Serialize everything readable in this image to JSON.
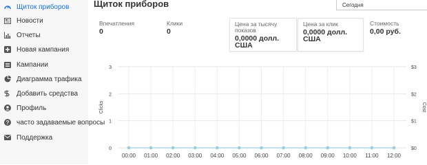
{
  "sidebar": {
    "items": [
      {
        "label": "Щиток приборов",
        "icon": "dashboard-icon",
        "active": true
      },
      {
        "label": "Новости",
        "icon": "news-icon"
      },
      {
        "label": "Отчеты",
        "icon": "reports-chart-icon"
      },
      {
        "label": "Новая кампания",
        "icon": "plus-square-icon"
      },
      {
        "label": "Кампании",
        "icon": "list-icon"
      },
      {
        "label": "Диаграмма трафика",
        "icon": "pie-chart-icon"
      },
      {
        "label": "Добавить средства",
        "icon": "money-icon"
      },
      {
        "label": "Профиль",
        "icon": "user-icon"
      },
      {
        "label": "часто задаваемые вопросы",
        "icon": "question-circle-icon"
      },
      {
        "label": "Поддержка",
        "icon": "envelope-icon"
      }
    ]
  },
  "header": {
    "title": "Щиток приборов",
    "period_select": "Сегодня"
  },
  "stats": [
    {
      "label": "Впечатления",
      "value": "0"
    },
    {
      "label": "Клики",
      "value": "0"
    },
    {
      "label": "Цена за тысячу показов",
      "value": "0,0000 долл. США"
    },
    {
      "label": "Цена за клик",
      "value": "0,0000 долл. США"
    },
    {
      "label": "Стоимость",
      "value": "0,00 руб."
    }
  ],
  "colors": {
    "accent": "#1a73e8",
    "series": "#9ecde0"
  },
  "chart_data": {
    "type": "line",
    "x": [
      "00:00",
      "01:00",
      "02:00",
      "03:00",
      "04:00",
      "05:00",
      "06:00",
      "07:00",
      "08:00",
      "09:00",
      "10:00",
      "11:00",
      "12:00"
    ],
    "series": [
      {
        "name": "Clicks",
        "values": [
          0,
          0,
          0,
          0,
          0,
          0,
          0,
          0,
          0,
          0,
          0,
          0,
          0
        ]
      }
    ],
    "ylabel": "Clicks",
    "y2label": "Cost",
    "ylim": [
      0,
      3
    ],
    "yticks": [
      "0",
      "1",
      "2",
      "3"
    ],
    "y2ticks": [
      "$0",
      "$1",
      "$2",
      "$3"
    ],
    "grid": true
  }
}
